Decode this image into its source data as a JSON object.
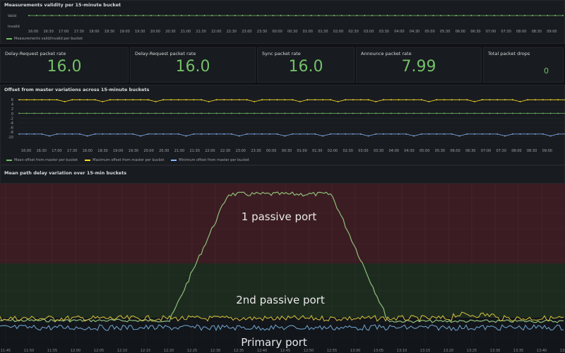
{
  "validity_panel": {
    "title": "Measurements validity per 15-minute bucket",
    "y_labels": [
      "Valid",
      "Invalid"
    ],
    "legend": "Measurements valid/invalid per bucket",
    "color": "#73bf69"
  },
  "time_ticks": [
    "16:00",
    "16:30",
    "17:00",
    "17:30",
    "18:00",
    "18:30",
    "19:00",
    "19:30",
    "20:00",
    "20:30",
    "21:00",
    "21:30",
    "22:00",
    "22:30",
    "23:00",
    "23:30",
    "00:00",
    "00:30",
    "01:00",
    "01:30",
    "02:00",
    "02:30",
    "03:00",
    "03:30",
    "04:00",
    "04:30",
    "05:00",
    "05:30",
    "06:00",
    "06:30",
    "07:00",
    "07:30",
    "08:00",
    "08:30",
    "09:00"
  ],
  "stats": [
    {
      "title": "Delay-Request packet rate",
      "value": "16.0"
    },
    {
      "title": "Delay-Request packet rate",
      "value": "16.0"
    },
    {
      "title": "Sync packet rate",
      "value": "16.0"
    },
    {
      "title": "Announce packet rate",
      "value": "7.99"
    },
    {
      "title": "Total packet drops",
      "value": "0"
    }
  ],
  "offset_panel": {
    "title": "Offset from master variations across 15-minute buckets",
    "y_ticks": [
      "6",
      "4",
      "2",
      "0",
      "-2",
      "-4",
      "-6",
      "-8",
      "-10"
    ],
    "legend": [
      {
        "label": "Mean offset from master per bucket",
        "color": "#73bf69"
      },
      {
        "label": "Maximum offset from master per bucket",
        "color": "#fade2a"
      },
      {
        "label": "Minimum offset from master per bucket",
        "color": "#8ab8ff"
      }
    ]
  },
  "path_delay_panel": {
    "title": "Mean path delay variation over 15-min buckets"
  },
  "bottom_chart": {
    "annotations": [
      "1 passive port",
      "2nd passive port",
      "Primary port"
    ],
    "x_ticks": [
      "11:45",
      "11:50",
      "11:55",
      "12:00",
      "12:05",
      "12:10",
      "12:15",
      "12:20",
      "12:25",
      "12:30",
      "12:35",
      "12:40",
      "12:45",
      "12:50",
      "12:55",
      "13:00",
      "13:05",
      "13:10",
      "13:15",
      "13:20",
      "13:25",
      "13:30",
      "13:35",
      "13:40",
      "13:45"
    ],
    "colors": {
      "top_band": "#3b1c22",
      "mid_band": "#1d2b1f",
      "low_band": "#12151a",
      "peak_line": "#8fbf7a",
      "yellow_line": "#c9b83a",
      "blue_line": "#6a9ec4"
    }
  }
}
